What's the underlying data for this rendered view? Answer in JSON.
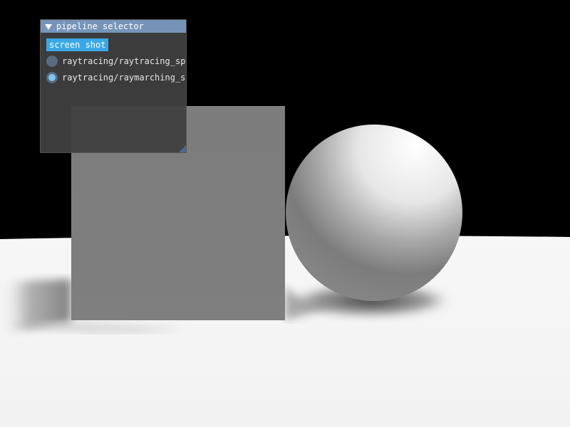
{
  "panel": {
    "title": "pipeline selector",
    "screenshot_label": "screen shot",
    "options": [
      {
        "label": "raytracing/raytracing_sphere",
        "selected": false
      },
      {
        "label": "raytracing/raymarching_sphere",
        "selected": true
      }
    ]
  },
  "colors": {
    "background": "#000000",
    "floor": "#f4f4f4",
    "cube": "#7e7e7e",
    "sphere_light": "#ffffff",
    "sphere_shadow": "#6e6e6e",
    "title_bar": "#7694b8",
    "button": "#3ba8e6",
    "radio_selected": "#7fc6f2"
  },
  "icons": {
    "collapse": "collapse-triangle-icon",
    "resize": "resize-grip-icon"
  }
}
